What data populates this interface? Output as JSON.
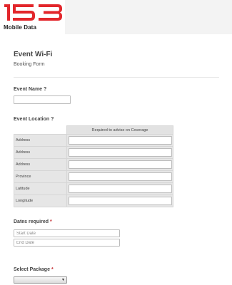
{
  "brand": {
    "logo_number": "153",
    "logo_text": "Mobile Data",
    "accent_color": "#e2262b"
  },
  "form": {
    "title": "Event Wi-Fi",
    "subtitle": "Booking Form"
  },
  "event_name": {
    "label": "Event Name ?",
    "value": ""
  },
  "event_location": {
    "label": "Event Location ?",
    "column_header": "Required to advise on Coverage",
    "rows": [
      "Address",
      "Address",
      "Address",
      "Province",
      "Latitude",
      "Longitude"
    ]
  },
  "dates": {
    "label": "Dates required",
    "required_mark": "*",
    "start_placeholder": "Start Date",
    "end_placeholder": "End Date"
  },
  "package": {
    "label": "Select Package",
    "required_mark": "*",
    "selected": ""
  }
}
